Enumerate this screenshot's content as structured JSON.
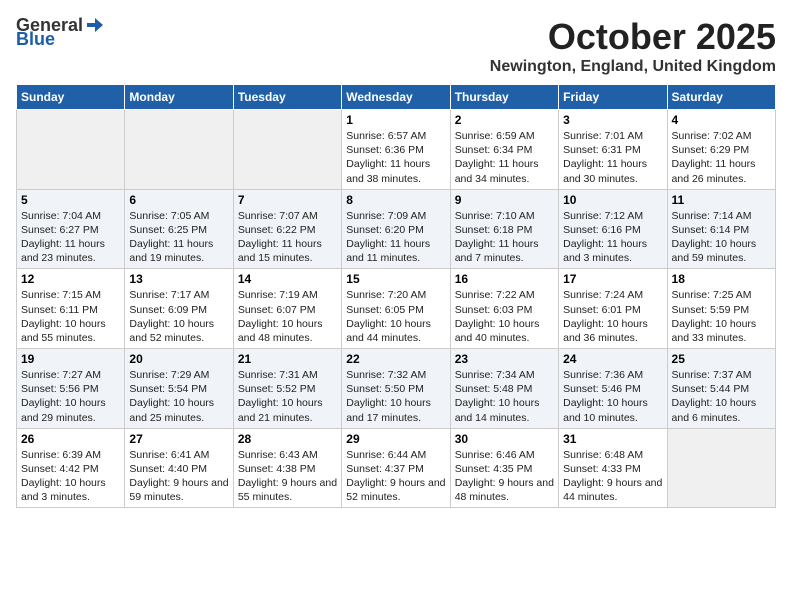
{
  "logo": {
    "general": "General",
    "blue": "Blue"
  },
  "title": "October 2025",
  "location": "Newington, England, United Kingdom",
  "days_of_week": [
    "Sunday",
    "Monday",
    "Tuesday",
    "Wednesday",
    "Thursday",
    "Friday",
    "Saturday"
  ],
  "weeks": [
    [
      {
        "day": "",
        "sunrise": "",
        "sunset": "",
        "daylight": "",
        "empty": true
      },
      {
        "day": "",
        "sunrise": "",
        "sunset": "",
        "daylight": "",
        "empty": true
      },
      {
        "day": "",
        "sunrise": "",
        "sunset": "",
        "daylight": "",
        "empty": true
      },
      {
        "day": "1",
        "sunrise": "Sunrise: 6:57 AM",
        "sunset": "Sunset: 6:36 PM",
        "daylight": "Daylight: 11 hours and 38 minutes."
      },
      {
        "day": "2",
        "sunrise": "Sunrise: 6:59 AM",
        "sunset": "Sunset: 6:34 PM",
        "daylight": "Daylight: 11 hours and 34 minutes."
      },
      {
        "day": "3",
        "sunrise": "Sunrise: 7:01 AM",
        "sunset": "Sunset: 6:31 PM",
        "daylight": "Daylight: 11 hours and 30 minutes."
      },
      {
        "day": "4",
        "sunrise": "Sunrise: 7:02 AM",
        "sunset": "Sunset: 6:29 PM",
        "daylight": "Daylight: 11 hours and 26 minutes."
      }
    ],
    [
      {
        "day": "5",
        "sunrise": "Sunrise: 7:04 AM",
        "sunset": "Sunset: 6:27 PM",
        "daylight": "Daylight: 11 hours and 23 minutes."
      },
      {
        "day": "6",
        "sunrise": "Sunrise: 7:05 AM",
        "sunset": "Sunset: 6:25 PM",
        "daylight": "Daylight: 11 hours and 19 minutes."
      },
      {
        "day": "7",
        "sunrise": "Sunrise: 7:07 AM",
        "sunset": "Sunset: 6:22 PM",
        "daylight": "Daylight: 11 hours and 15 minutes."
      },
      {
        "day": "8",
        "sunrise": "Sunrise: 7:09 AM",
        "sunset": "Sunset: 6:20 PM",
        "daylight": "Daylight: 11 hours and 11 minutes."
      },
      {
        "day": "9",
        "sunrise": "Sunrise: 7:10 AM",
        "sunset": "Sunset: 6:18 PM",
        "daylight": "Daylight: 11 hours and 7 minutes."
      },
      {
        "day": "10",
        "sunrise": "Sunrise: 7:12 AM",
        "sunset": "Sunset: 6:16 PM",
        "daylight": "Daylight: 11 hours and 3 minutes."
      },
      {
        "day": "11",
        "sunrise": "Sunrise: 7:14 AM",
        "sunset": "Sunset: 6:14 PM",
        "daylight": "Daylight: 10 hours and 59 minutes."
      }
    ],
    [
      {
        "day": "12",
        "sunrise": "Sunrise: 7:15 AM",
        "sunset": "Sunset: 6:11 PM",
        "daylight": "Daylight: 10 hours and 55 minutes."
      },
      {
        "day": "13",
        "sunrise": "Sunrise: 7:17 AM",
        "sunset": "Sunset: 6:09 PM",
        "daylight": "Daylight: 10 hours and 52 minutes."
      },
      {
        "day": "14",
        "sunrise": "Sunrise: 7:19 AM",
        "sunset": "Sunset: 6:07 PM",
        "daylight": "Daylight: 10 hours and 48 minutes."
      },
      {
        "day": "15",
        "sunrise": "Sunrise: 7:20 AM",
        "sunset": "Sunset: 6:05 PM",
        "daylight": "Daylight: 10 hours and 44 minutes."
      },
      {
        "day": "16",
        "sunrise": "Sunrise: 7:22 AM",
        "sunset": "Sunset: 6:03 PM",
        "daylight": "Daylight: 10 hours and 40 minutes."
      },
      {
        "day": "17",
        "sunrise": "Sunrise: 7:24 AM",
        "sunset": "Sunset: 6:01 PM",
        "daylight": "Daylight: 10 hours and 36 minutes."
      },
      {
        "day": "18",
        "sunrise": "Sunrise: 7:25 AM",
        "sunset": "Sunset: 5:59 PM",
        "daylight": "Daylight: 10 hours and 33 minutes."
      }
    ],
    [
      {
        "day": "19",
        "sunrise": "Sunrise: 7:27 AM",
        "sunset": "Sunset: 5:56 PM",
        "daylight": "Daylight: 10 hours and 29 minutes."
      },
      {
        "day": "20",
        "sunrise": "Sunrise: 7:29 AM",
        "sunset": "Sunset: 5:54 PM",
        "daylight": "Daylight: 10 hours and 25 minutes."
      },
      {
        "day": "21",
        "sunrise": "Sunrise: 7:31 AM",
        "sunset": "Sunset: 5:52 PM",
        "daylight": "Daylight: 10 hours and 21 minutes."
      },
      {
        "day": "22",
        "sunrise": "Sunrise: 7:32 AM",
        "sunset": "Sunset: 5:50 PM",
        "daylight": "Daylight: 10 hours and 17 minutes."
      },
      {
        "day": "23",
        "sunrise": "Sunrise: 7:34 AM",
        "sunset": "Sunset: 5:48 PM",
        "daylight": "Daylight: 10 hours and 14 minutes."
      },
      {
        "day": "24",
        "sunrise": "Sunrise: 7:36 AM",
        "sunset": "Sunset: 5:46 PM",
        "daylight": "Daylight: 10 hours and 10 minutes."
      },
      {
        "day": "25",
        "sunrise": "Sunrise: 7:37 AM",
        "sunset": "Sunset: 5:44 PM",
        "daylight": "Daylight: 10 hours and 6 minutes."
      }
    ],
    [
      {
        "day": "26",
        "sunrise": "Sunrise: 6:39 AM",
        "sunset": "Sunset: 4:42 PM",
        "daylight": "Daylight: 10 hours and 3 minutes."
      },
      {
        "day": "27",
        "sunrise": "Sunrise: 6:41 AM",
        "sunset": "Sunset: 4:40 PM",
        "daylight": "Daylight: 9 hours and 59 minutes."
      },
      {
        "day": "28",
        "sunrise": "Sunrise: 6:43 AM",
        "sunset": "Sunset: 4:38 PM",
        "daylight": "Daylight: 9 hours and 55 minutes."
      },
      {
        "day": "29",
        "sunrise": "Sunrise: 6:44 AM",
        "sunset": "Sunset: 4:37 PM",
        "daylight": "Daylight: 9 hours and 52 minutes."
      },
      {
        "day": "30",
        "sunrise": "Sunrise: 6:46 AM",
        "sunset": "Sunset: 4:35 PM",
        "daylight": "Daylight: 9 hours and 48 minutes."
      },
      {
        "day": "31",
        "sunrise": "Sunrise: 6:48 AM",
        "sunset": "Sunset: 4:33 PM",
        "daylight": "Daylight: 9 hours and 44 minutes."
      },
      {
        "day": "",
        "sunrise": "",
        "sunset": "",
        "daylight": "",
        "empty": true
      }
    ]
  ]
}
